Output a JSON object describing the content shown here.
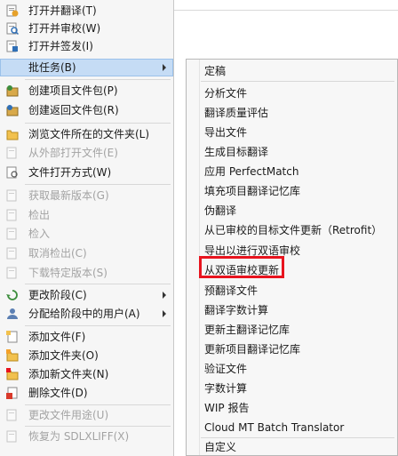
{
  "main_menu": {
    "items": [
      {
        "label": "打开并翻译(T)",
        "icon": "translate-document-icon",
        "disabled": false
      },
      {
        "label": "打开并审校(W)",
        "icon": "review-document-icon",
        "disabled": false
      },
      {
        "label": "打开并签发(I)",
        "icon": "signoff-document-icon",
        "disabled": false
      },
      {
        "label": "批任务(B)",
        "icon": "",
        "disabled": false,
        "submenu": true,
        "highlighted": true
      },
      {
        "label": "创建项目文件包(P)",
        "icon": "create-project-package-icon",
        "disabled": false
      },
      {
        "label": "创建返回文件包(R)",
        "icon": "create-return-package-icon",
        "disabled": false
      },
      {
        "label": "浏览文件所在的文件夹(L)",
        "icon": "folder-open-icon",
        "disabled": false
      },
      {
        "label": "从外部打开文件(E)",
        "icon": "open-external-icon",
        "disabled": true
      },
      {
        "label": "文件打开方式(W)",
        "icon": "open-with-icon",
        "disabled": false
      },
      {
        "label": "获取最新版本(G)",
        "icon": "get-latest-icon",
        "disabled": true
      },
      {
        "label": "检出",
        "icon": "check-out-icon",
        "disabled": true
      },
      {
        "label": "检入",
        "icon": "check-in-icon",
        "disabled": true
      },
      {
        "label": "取消检出(C)",
        "icon": "undo-check-out-icon",
        "disabled": true
      },
      {
        "label": "下载特定版本(S)",
        "icon": "download-version-icon",
        "disabled": true
      },
      {
        "label": "更改阶段(C)",
        "icon": "change-phase-icon",
        "disabled": false,
        "submenu": true
      },
      {
        "label": "分配给阶段中的用户(A)",
        "icon": "assign-user-icon",
        "disabled": false,
        "submenu": true
      },
      {
        "label": "添加文件(F)",
        "icon": "add-file-icon",
        "disabled": false
      },
      {
        "label": "添加文件夹(O)",
        "icon": "add-folder-icon",
        "disabled": false
      },
      {
        "label": "添加新文件夹(N)",
        "icon": "add-new-folder-icon",
        "disabled": false
      },
      {
        "label": "删除文件(D)",
        "icon": "delete-file-icon",
        "disabled": false
      },
      {
        "label": "更改文件用途(U)",
        "icon": "change-usage-icon",
        "disabled": true
      },
      {
        "label": "恢复为 SDLXLIFF(X)",
        "icon": "revert-sdlxliff-icon",
        "disabled": true
      }
    ]
  },
  "batch_submenu": {
    "items": [
      "定稿",
      "分析文件",
      "翻译质量评估",
      "导出文件",
      "生成目标翻译",
      "应用 PerfectMatch",
      "填充项目翻译记忆库",
      "伪翻译",
      "从已审校的目标文件更新（Retrofit）",
      "导出以进行双语审校",
      "从双语审校更新",
      "预翻译文件",
      "翻译字数计算",
      "更新主翻译记忆库",
      "更新项目翻译记忆库",
      "验证文件",
      "字数计算",
      "WIP 报告",
      "Cloud MT Batch Translator",
      "自定义"
    ],
    "highlighted_index": 10
  },
  "colors": {
    "highlight_bg": "#c5dcf5",
    "red_box": "#e8141e",
    "disabled_text": "#a3a3a3"
  }
}
